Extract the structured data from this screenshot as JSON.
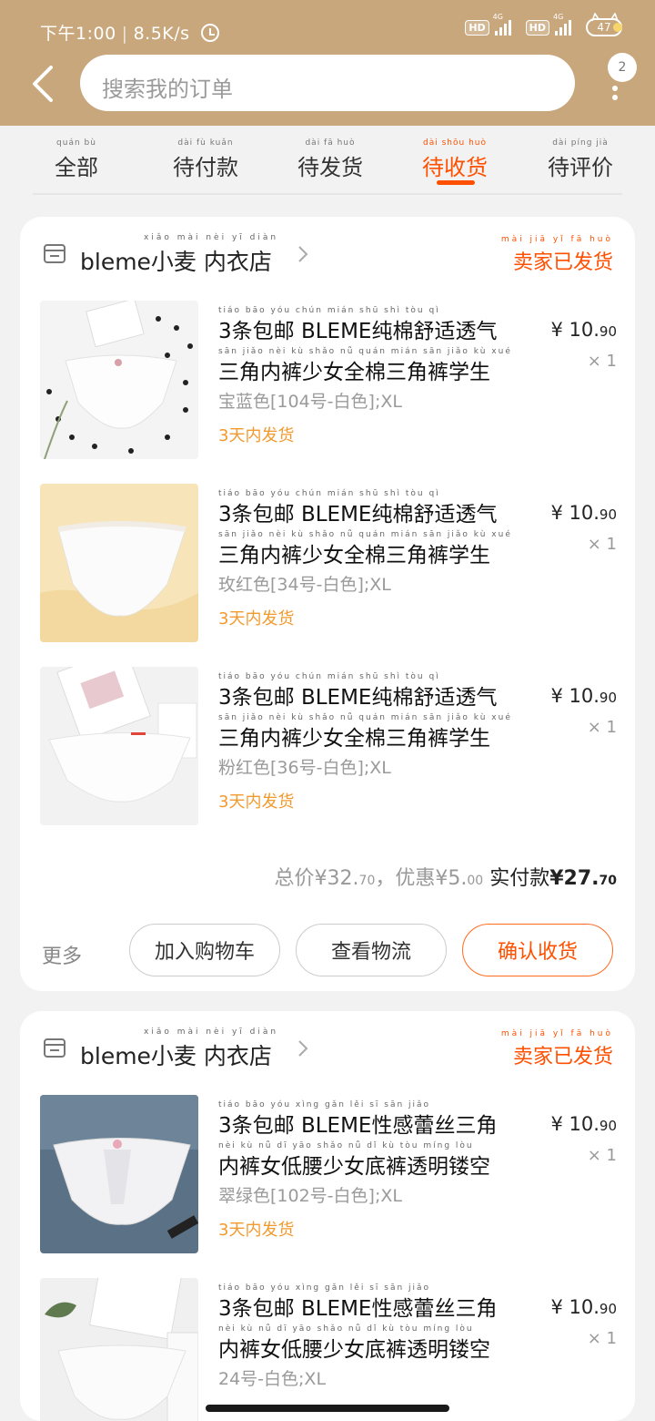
{
  "status_bar": {
    "time": "下午1:00",
    "speed": "8.5K/s",
    "hd1": "HD",
    "net1": "4G",
    "hd2": "HD",
    "net2": "4G",
    "battery": "47"
  },
  "search": {
    "placeholder": "搜索我的订单"
  },
  "more_badge": "2",
  "tabs": [
    {
      "label": "全部",
      "pinyin": "quán bù"
    },
    {
      "label": "待付款",
      "pinyin": "dài fù kuǎn"
    },
    {
      "label": "待发货",
      "pinyin": "dài fā huò"
    },
    {
      "label": "待收货",
      "pinyin": "dài shōu huò",
      "active": true
    },
    {
      "label": "待评价",
      "pinyin": "dài píng jià"
    }
  ],
  "orders": [
    {
      "shop": "bleme小麦 内衣店",
      "shop_pinyin": "xiǎo mài nèi yī diàn",
      "status": "卖家已发货",
      "status_pinyin": "mài jiā yǐ fā huò",
      "items": [
        {
          "title_line1": "3条包邮 BLEME纯棉舒适透气",
          "title_line2": "三角内裤少女全棉三角裤学生",
          "title_py1": "tiáo bāo yóu chún mián shū shì tòu qì",
          "title_py2": "sān jiǎo nèi kù shǎo nǚ quán mián sān jiǎo kù xué",
          "sku": "宝蓝色[104号-白色];XL",
          "shipping": "3天内发货",
          "price_int": "¥ 10.",
          "price_dec": "90",
          "qty": "× 1"
        },
        {
          "title_line1": "3条包邮 BLEME纯棉舒适透气",
          "title_line2": "三角内裤少女全棉三角裤学生",
          "title_py1": "tiáo bāo yóu chún mián shū shì tòu qì",
          "title_py2": "sān jiǎo nèi kù shǎo nǚ quán mián sān jiǎo kù xué",
          "sku": "玫红色[34号-白色];XL",
          "shipping": "3天内发货",
          "price_int": "¥ 10.",
          "price_dec": "90",
          "qty": "× 1"
        },
        {
          "title_line1": "3条包邮 BLEME纯棉舒适透气",
          "title_line2": "三角内裤少女全棉三角裤学生",
          "title_py1": "tiáo bāo yóu chún mián shū shì tòu qì",
          "title_py2": "sān jiǎo nèi kù shǎo nǚ quán mián sān jiǎo kù xué",
          "sku": "粉红色[36号-白色];XL",
          "shipping": "3天内发货",
          "price_int": "¥ 10.",
          "price_dec": "90",
          "qty": "× 1"
        }
      ],
      "summary": {
        "total_label": "总价",
        "total_int": "¥32.",
        "total_dec": "70",
        "discount_label": "，优惠",
        "discount_int": "¥5.",
        "discount_dec": "00",
        "pay_label": "实付款",
        "pay_int": "¥27.",
        "pay_dec": "70"
      },
      "actions": {
        "more": "更多",
        "add_cart": "加入购物车",
        "logistics": "查看物流",
        "confirm": "确认收货"
      }
    },
    {
      "shop": "bleme小麦 内衣店",
      "shop_pinyin": "xiǎo mài nèi yī diàn",
      "status": "卖家已发货",
      "status_pinyin": "mài jiā yǐ fā huò",
      "items": [
        {
          "title_line1": "3条包邮 BLEME性感蕾丝三角",
          "title_line2": "内裤女低腰少女底裤透明镂空",
          "title_py1": "tiáo bāo yóu xìng gǎn lěi sī sān jiǎo",
          "title_py2": "nèi kù nǚ dī yāo shǎo nǚ dǐ kù tòu míng lòu",
          "sku": "翠绿色[102号-白色];XL",
          "shipping": "3天内发货",
          "price_int": "¥ 10.",
          "price_dec": "90",
          "qty": "× 1"
        },
        {
          "title_line1": "3条包邮 BLEME性感蕾丝三角",
          "title_line2": "内裤女低腰少女底裤透明镂空",
          "title_py1": "tiáo bāo yóu xìng gǎn lěi sī sān jiǎo",
          "title_py2": "nèi kù nǚ dī yāo shǎo nǚ dǐ kù tòu míng lòu",
          "sku": "24号-白色;XL",
          "price_int": "¥ 10.",
          "price_dec": "90",
          "qty": "× 1"
        }
      ]
    }
  ],
  "colors": {
    "header": "#c9a77c",
    "accent": "#ff5000",
    "shipping": "#f29a2e"
  }
}
